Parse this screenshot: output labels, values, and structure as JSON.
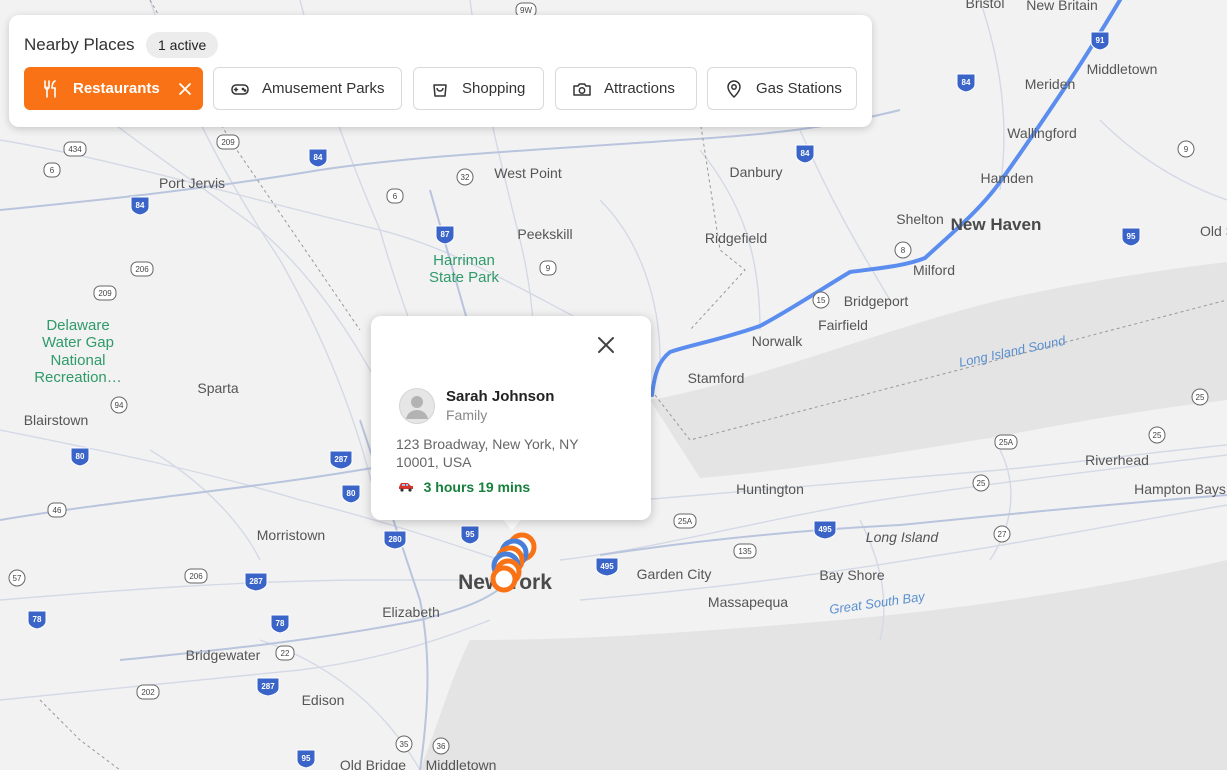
{
  "panel": {
    "title": "Nearby Places",
    "active_badge": "1 active",
    "chips": [
      {
        "label": "Restaurants",
        "icon": "utensils-icon",
        "active": true
      },
      {
        "label": "Amusement Parks",
        "icon": "gamepad-icon",
        "active": false
      },
      {
        "label": "Shopping",
        "icon": "shopping-bag-icon",
        "active": false
      },
      {
        "label": "Attractions",
        "icon": "camera-icon",
        "active": false
      },
      {
        "label": "Gas Stations",
        "icon": "map-pin-icon",
        "active": false
      }
    ]
  },
  "popup": {
    "name": "Sarah Johnson",
    "relation": "Family",
    "address": "123 Broadway, New York, NY 10001, USA",
    "travel_time": "3 hours 19 mins",
    "travel_icon": "car-icon"
  },
  "colors": {
    "accent": "#f97316",
    "route": "#5b8def",
    "travel_time": "#16803c",
    "water": "#e3e3e3"
  },
  "map": {
    "places": {
      "new_york": "New York",
      "new_haven": "New Haven",
      "stamford": "Stamford",
      "bridgeport": "Bridgeport",
      "norwalk": "Norwalk",
      "fairfield": "Fairfield",
      "milford": "Milford",
      "shelton": "Shelton",
      "hamden": "Hamden",
      "wallingford": "Wallingford",
      "meriden": "Meriden",
      "middletown_ct": "Middletown",
      "new_britain": "New Britain",
      "bristol": "Bristol",
      "danbury": "Danbury",
      "ridgefield": "Ridgefield",
      "peekskill": "Peekskill",
      "west_point": "West Point",
      "port_jervis": "Port Jervis",
      "sparta": "Sparta",
      "blairstown": "Blairstown",
      "morristown": "Morristown",
      "elizabeth": "Elizabeth",
      "bridgewater": "Bridgewater",
      "edison": "Edison",
      "old_bridge": "Old Bridge",
      "middletown_nj": "Middletown",
      "huntington": "Huntington",
      "garden_city": "Garden City",
      "massapequa": "Massapequa",
      "bay_shore": "Bay Shore",
      "riverhead": "Riverhead",
      "hampton_bays": "Hampton Bays",
      "old_s": "Old S"
    },
    "parks": {
      "harriman_1": "Harriman",
      "harriman_2": "State Park",
      "delaware_1": "Delaware",
      "delaware_2": "Water Gap",
      "delaware_3": "National",
      "delaware_4": "Recreation…"
    },
    "water": {
      "long_island_sound": "Long Island Sound",
      "great_south_bay": "Great South Bay"
    },
    "regions": {
      "long_island": "Long Island"
    },
    "interstate_shields": [
      "84",
      "84",
      "84",
      "84",
      "91",
      "95",
      "95",
      "95",
      "87",
      "287",
      "287",
      "287",
      "80",
      "80",
      "78",
      "280",
      "495",
      "495"
    ],
    "state_shields": [
      "434",
      "6",
      "6",
      "209",
      "209",
      "206",
      "206",
      "32",
      "9",
      "94",
      "46",
      "57",
      "202",
      "22",
      "15",
      "8",
      "9",
      "25",
      "25",
      "25",
      "25A",
      "25A",
      "27",
      "135",
      "35",
      "36",
      "9W"
    ]
  }
}
